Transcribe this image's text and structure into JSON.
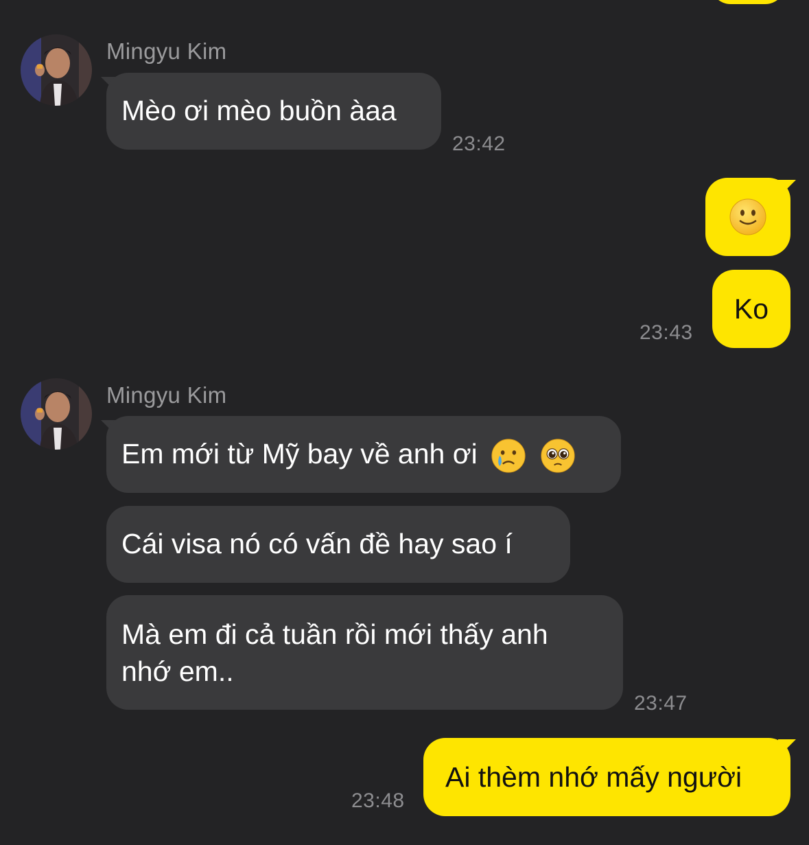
{
  "colors": {
    "background": "#232325",
    "incoming_bubble": "#3a3a3c",
    "outgoing_bubble": "#FEE500",
    "time_text": "#8d8d90",
    "name_text": "#9b9b9d"
  },
  "messages": {
    "group1": {
      "sender": "Mingyu Kim",
      "text": "Mèo ơi mèo buồn àaa",
      "time": "23:42"
    },
    "group2": {
      "emoji_name": "slightly-smiling-face-icon",
      "text": "Ko",
      "time": "23:43"
    },
    "group3": {
      "sender": "Mingyu Kim",
      "text1": "Em mới từ Mỹ bay về anh ơi",
      "text1_emojis": [
        "crying-face-icon",
        "pleading-face-icon"
      ],
      "text2": "Cái visa nó có vấn đề hay sao í",
      "text3_line1": "Mà em đi cả tuần rồi mới thấy anh",
      "text3_line2": "nhớ em..",
      "time": "23:47"
    },
    "group4": {
      "text": "Ai thèm nhớ mấy người",
      "time": "23:48"
    }
  }
}
